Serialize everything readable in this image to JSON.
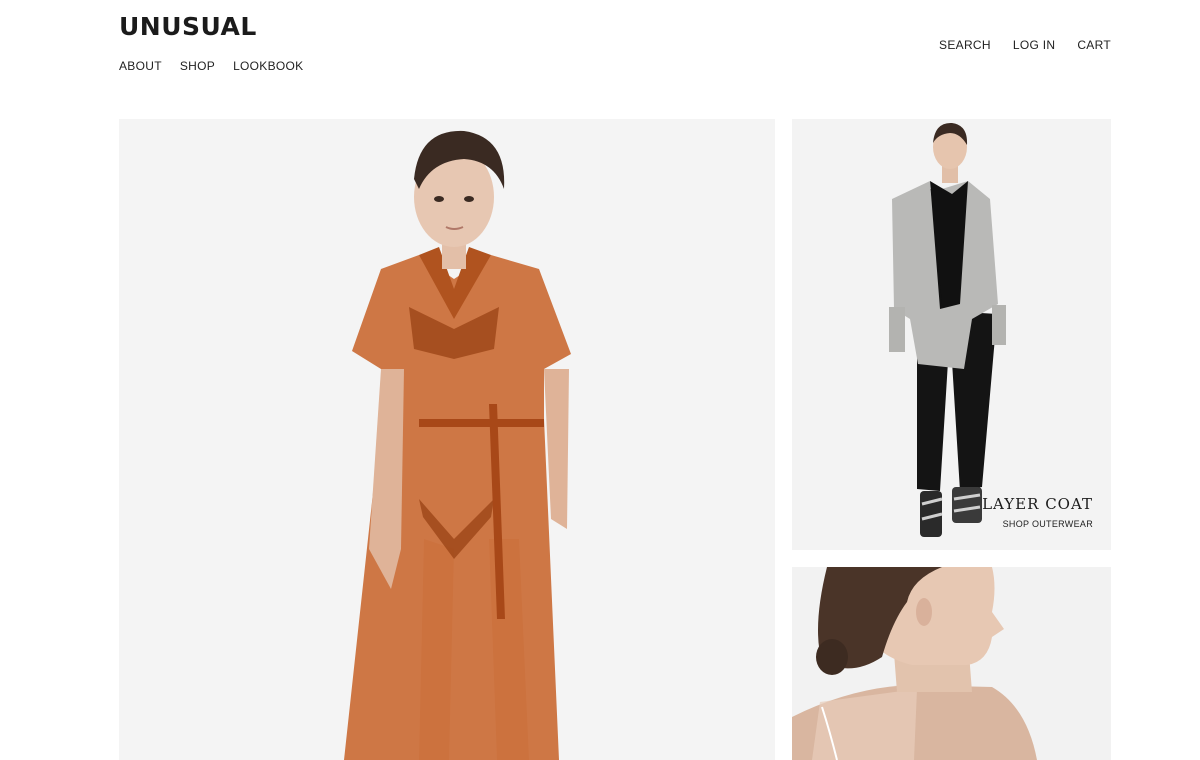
{
  "brand": {
    "name": "UNUSUAL"
  },
  "nav": {
    "main": [
      "ABOUT",
      "SHOP",
      "LOOKBOOK"
    ],
    "utility": [
      "SEARCH",
      "LOG IN",
      "CART"
    ]
  },
  "tiles": {
    "hero": {
      "icon": "model-orange-dress-photo"
    },
    "coat": {
      "icon": "model-grey-coat-photo",
      "title": "LAYER COAT",
      "link": "SHOP OUTERWEAR"
    },
    "detail": {
      "icon": "model-profile-detail-photo"
    }
  },
  "colors": {
    "dress": "#c8652c",
    "coat": "#b9b9b7",
    "pants": "#141414",
    "skin": "#e4c2ac",
    "background": "#f4f4f4"
  }
}
